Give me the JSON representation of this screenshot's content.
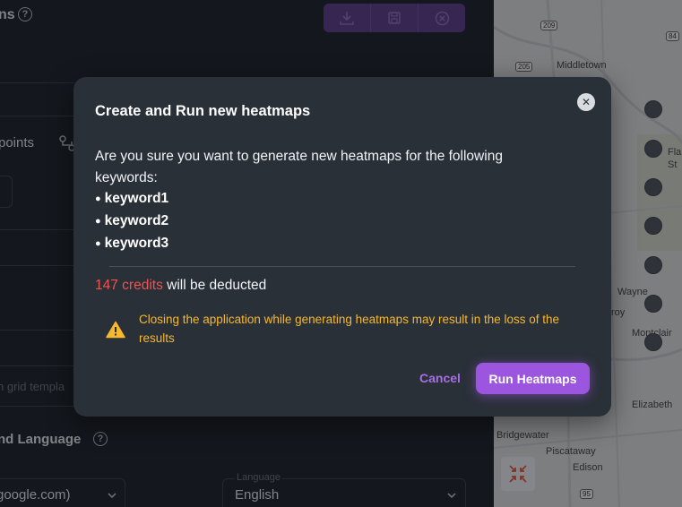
{
  "background": {
    "toolbar": {
      "buttons": [
        {
          "icon": "download-icon"
        },
        {
          "icon": "save-icon"
        },
        {
          "icon": "cancel-circle-icon"
        }
      ]
    },
    "section_top_fragment": "ns",
    "points_label_fragment": "points",
    "grid_template_placeholder_fragment": "n grid templa",
    "language_section_fragment": "nd Language",
    "google_domain_fragment": "google.com)",
    "language_field": {
      "label": "Language",
      "value": "English"
    }
  },
  "map": {
    "towns": [
      "Middletown",
      "Wayne",
      "Montclair",
      "Elizabeth",
      "Bridgewater",
      "Piscataway",
      "Edison",
      "roy",
      "Fla",
      "St"
    ],
    "road_shields": [
      "209",
      "205",
      "84",
      "95"
    ],
    "pin_count": 7
  },
  "modal": {
    "title": "Create and Run new heatmaps",
    "question": "Are you sure you want to generate new heatmaps for the following keywords:",
    "keywords": [
      "keyword1",
      "keyword2",
      "keyword3"
    ],
    "credits_amount": "147 credits",
    "credits_suffix": " will be deducted",
    "warning": "Closing the application while generating heatmaps may result in the loss of the results",
    "cancel_label": "Cancel",
    "run_label": "Run Heatmaps",
    "colors": {
      "accent": "#9b55de",
      "warning": "#f5b82e",
      "credits": "#ef5350"
    }
  }
}
